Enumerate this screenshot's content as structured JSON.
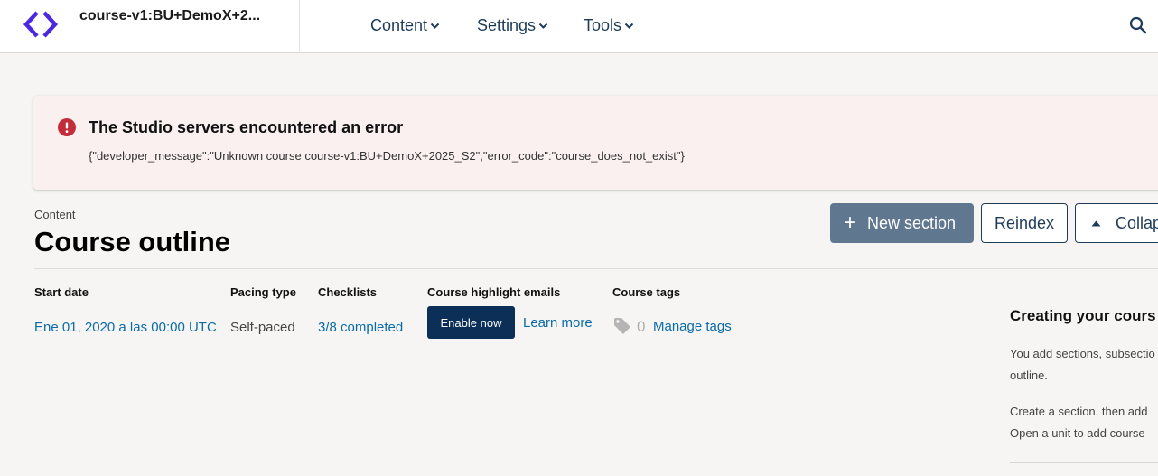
{
  "header": {
    "course_title": "course-v1:BU+DemoX+2...",
    "nav": [
      {
        "label": "Content"
      },
      {
        "label": "Settings"
      },
      {
        "label": "Tools"
      }
    ],
    "logo_icon": "studio-logo-icon",
    "search_icon": "search-icon"
  },
  "alert": {
    "title": "The Studio servers encountered an error",
    "message": "{\"developer_message\":\"Unknown course course-v1:BU+DemoX+2025_S2\",\"error_code\":\"course_does_not_exist\"}",
    "icon": "error-icon"
  },
  "page": {
    "breadcrumb": "Content",
    "title": "Course outline"
  },
  "actions": {
    "new_section": "New section",
    "reindex": "Reindex",
    "collapse": "Collap"
  },
  "stats": {
    "start_date": {
      "label": "Start date",
      "value": "Ene 01, 2020 a las 00:00 UTC"
    },
    "pacing_type": {
      "label": "Pacing type",
      "value": "Self-paced"
    },
    "checklists": {
      "label": "Checklists",
      "value": "3/8 completed"
    },
    "highlight_emails": {
      "label": "Course highlight emails",
      "button": "Enable now",
      "link": "Learn more"
    },
    "course_tags": {
      "label": "Course tags",
      "count": "0",
      "link": "Manage tags"
    }
  },
  "sidebar": {
    "title": "Creating your cours",
    "p1_line1": "You add sections, subsectio",
    "p1_line2": "outline.",
    "p2_line1": "Create a section, then add",
    "p2_line2": "Open a unit to add course"
  },
  "colors": {
    "brand": "#4b28e0",
    "nav_text": "#1f3b5a",
    "alert_bg": "#fbf0f0",
    "error_red": "#c32d3a",
    "link": "#0a6ba8",
    "primary_dark": "#0b2f57",
    "new_section_bg": "#5f7890"
  }
}
